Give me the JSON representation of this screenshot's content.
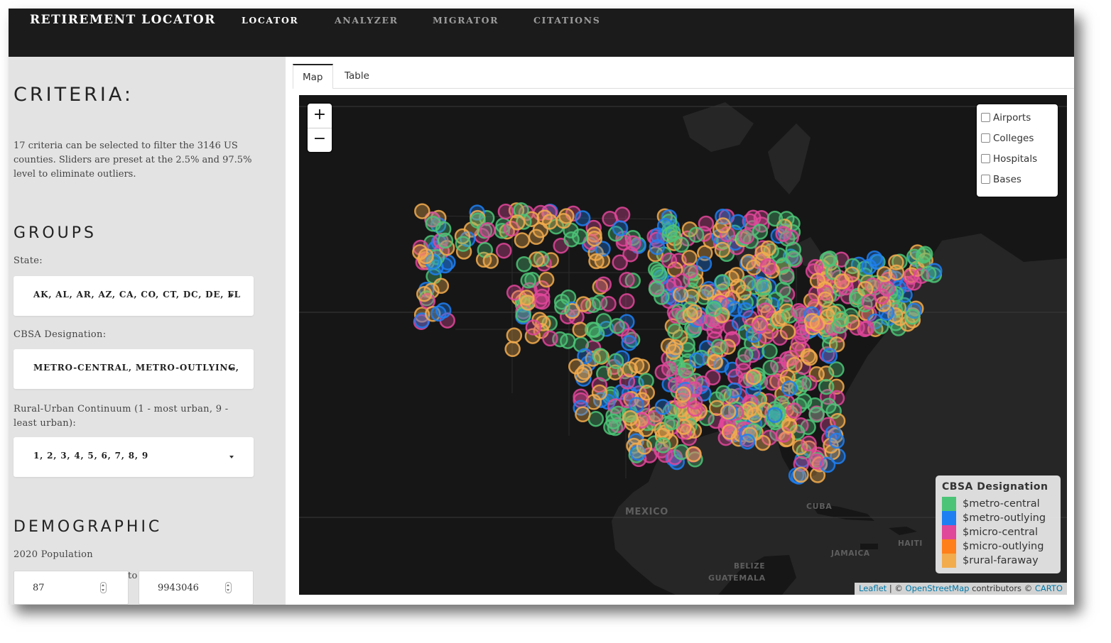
{
  "navbar": {
    "brand": "RETIREMENT LOCATOR",
    "links": [
      {
        "label": "LOCATOR",
        "active": true
      },
      {
        "label": "ANALYZER",
        "active": false
      },
      {
        "label": "MIGRATOR",
        "active": false
      },
      {
        "label": "CITATIONS",
        "active": false
      }
    ]
  },
  "sidebar": {
    "criteria_title": "CRITERIA:",
    "description": "17 criteria can be selected to filter the 3146 US counties. Sliders are preset at the 2.5% and 97.5% level to eliminate outliers.",
    "groups_title": "GROUPS",
    "state_label": "State:",
    "state_value": "AK, AL, AR, AZ, CA, CO, CT, DC, DE, FL",
    "cbsa_label": "CBSA Designation:",
    "cbsa_value": "METRO-CENTRAL, METRO-OUTLYING,",
    "ruc_label": "Rural-Urban Continuum (1 - most urban, 9 - least urban):",
    "ruc_value": "1, 2, 3, 4, 5, 6, 7, 8, 9",
    "demographic_title": "DEMOGRAPHIC",
    "population_label": "2020 Population",
    "population_min": "87",
    "population_to": "to",
    "population_max": "9943046"
  },
  "tabs": [
    {
      "label": "Map",
      "active": true
    },
    {
      "label": "Table",
      "active": false
    }
  ],
  "map": {
    "zoom_in": "+",
    "zoom_out": "−",
    "layers": [
      "Airports",
      "Colleges",
      "Hospitals",
      "Bases"
    ],
    "legend": {
      "title": "CBSA Designation",
      "items": [
        {
          "label": "$metro-central",
          "color": "#4cc477"
        },
        {
          "label": "$metro-outlying",
          "color": "#1e7ff2"
        },
        {
          "label": "$micro-central",
          "color": "#e0479a"
        },
        {
          "label": "$micro-outlying",
          "color": "#ff7f1a"
        },
        {
          "label": "$rural-faraway",
          "color": "#f2ac4e"
        }
      ]
    },
    "country_labels": [
      "MEXICO",
      "CUBA",
      "JAMAICA",
      "HAITI",
      "BELIZE",
      "GUATEMALA"
    ],
    "attribution": {
      "leaflet": "Leaflet",
      "sep": " | © ",
      "osm": "OpenStreetMap",
      "mid": " contributors © ",
      "carto": "CARTO"
    }
  }
}
